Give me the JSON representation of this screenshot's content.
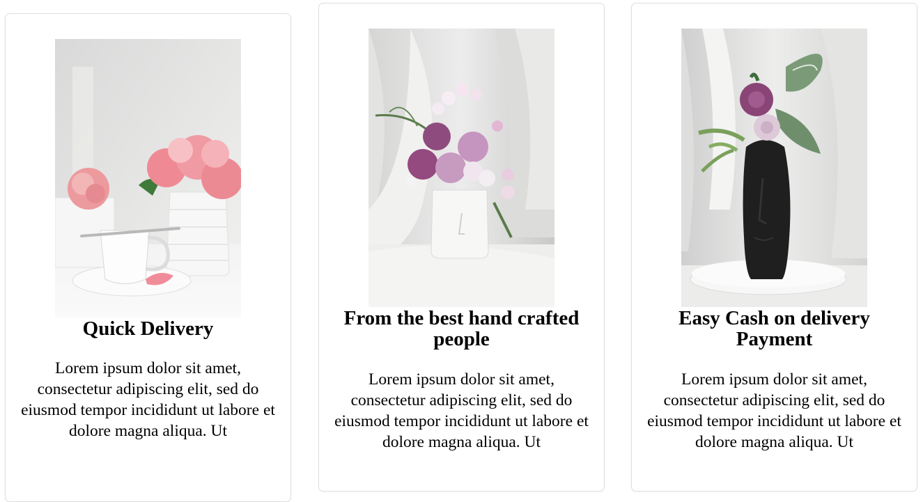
{
  "cards": [
    {
      "title": "Quick Delivery",
      "text": "Lorem ipsum dolor sit amet, consectetur adipiscing elit, sed do eiusmod tempor incididunt ut labore et dolore magna aliqua. Ut"
    },
    {
      "title": "From the best hand crafted people",
      "text": "Lorem ipsum dolor sit amet, consectetur adipiscing elit, sed do eiusmod tempor incididunt ut labore et dolore magna aliqua. Ut"
    },
    {
      "title": "Easy Cash on delivery Payment",
      "text": "Lorem ipsum dolor sit amet, consectetur adipiscing elit, sed do eiusmod tempor incididunt ut labore et dolore magna aliqua. Ut"
    }
  ],
  "colors": {
    "card_border": "#dedede",
    "text": "#000000",
    "background": "#ffffff"
  }
}
